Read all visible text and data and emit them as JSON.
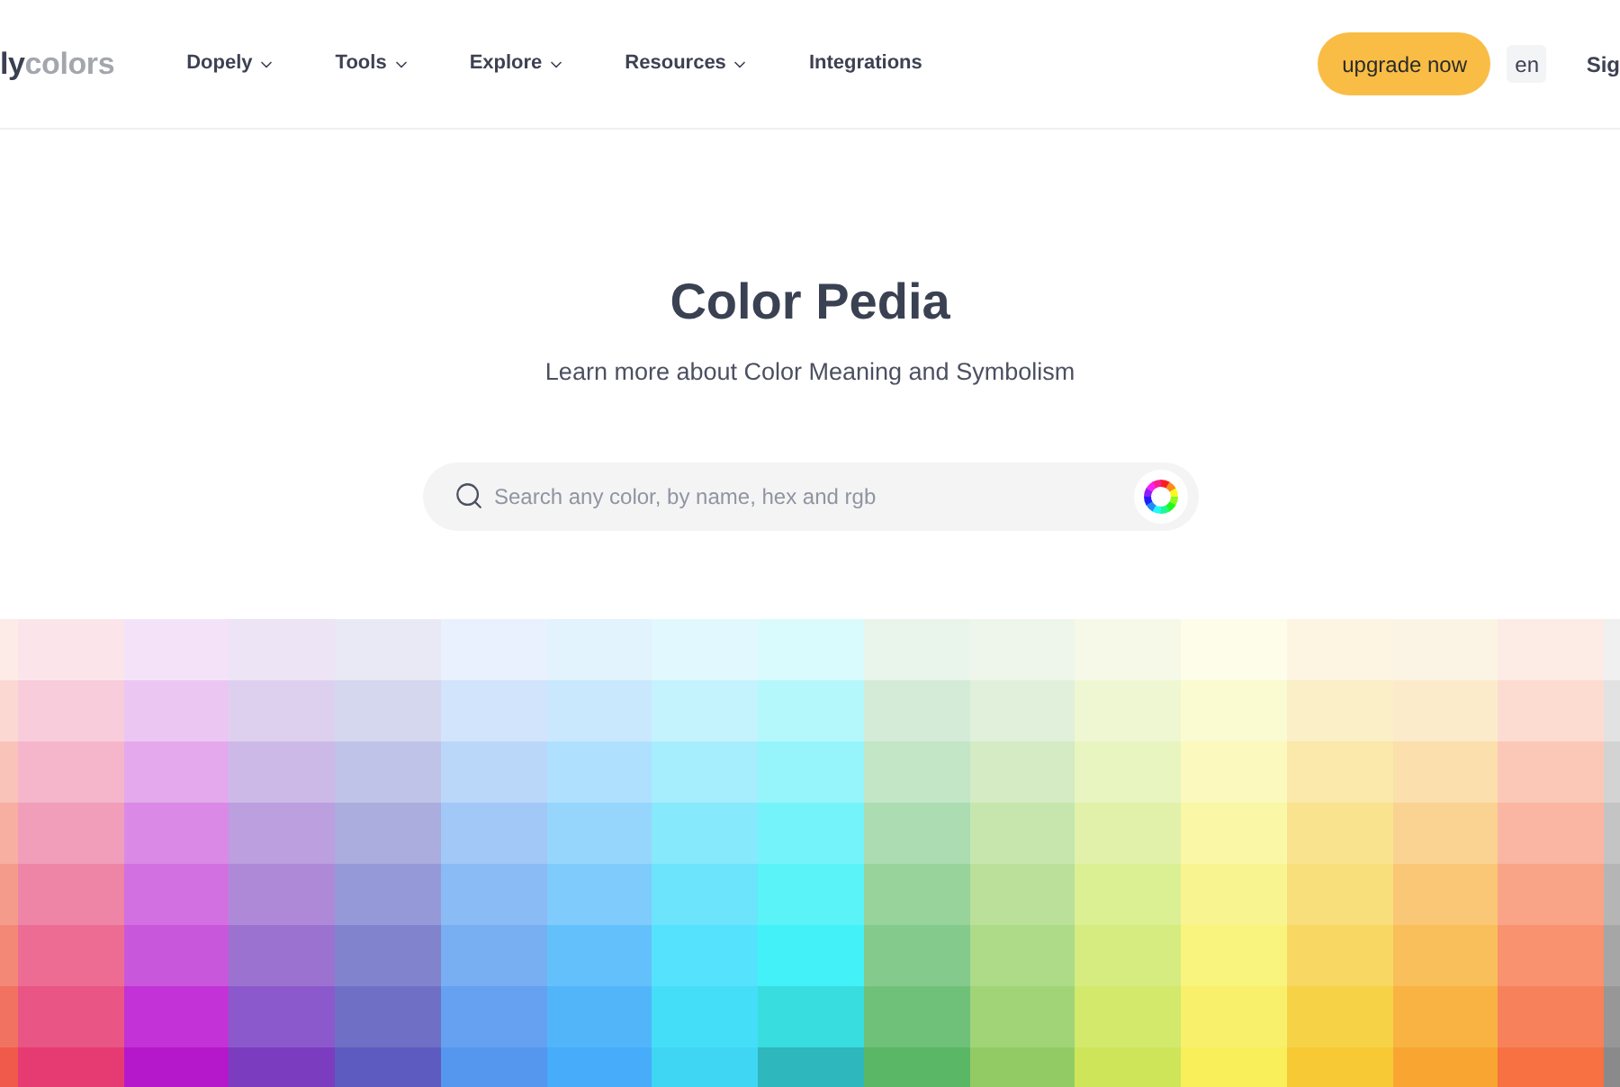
{
  "header": {
    "logo": {
      "dark_part": "ly",
      "light_part": "colors"
    },
    "nav": [
      {
        "label": "Dopely",
        "dropdown": true
      },
      {
        "label": "Tools",
        "dropdown": true
      },
      {
        "label": "Explore",
        "dropdown": true
      },
      {
        "label": "Resources",
        "dropdown": true
      },
      {
        "label": "Integrations",
        "dropdown": false
      }
    ],
    "upgrade_button": "upgrade now",
    "language": "en",
    "sign_in": "Sig"
  },
  "hero": {
    "title": "Color Pedia",
    "subtitle": "Learn more about Color Meaning and Symbolism",
    "search": {
      "placeholder": "Search any color, by name, hex and rgb"
    }
  },
  "color_grid": [
    {
      "swatches": [
        {
          "color": "#fdebe7"
        },
        {
          "color": "#fcd8d2"
        },
        {
          "color": "#f9c3ba"
        },
        {
          "color": "#f7afa2"
        },
        {
          "color": "#f59b8c"
        },
        {
          "color": "#f38877"
        },
        {
          "color": "#f27262"
        },
        {
          "color": "#f05a4a"
        }
      ]
    },
    {
      "swatches": [
        {
          "color": "#fbe5eb"
        },
        {
          "color": "#f8ccdb"
        },
        {
          "color": "#f5b6cb"
        },
        {
          "color": "#f19ebb"
        },
        {
          "color": "#ee84a6"
        },
        {
          "color": "#ec6c94"
        },
        {
          "color": "#e95584"
        },
        {
          "color": "#e63b72"
        }
      ]
    },
    {
      "swatches": [
        {
          "color": "#f4e3f8"
        },
        {
          "color": "#ecc6f2"
        },
        {
          "color": "#e3a9ec"
        },
        {
          "color": "#da8ae6"
        },
        {
          "color": "#d270e1"
        },
        {
          "color": "#c957db"
        },
        {
          "color": "#c232d6"
        },
        {
          "color": "#b518cb"
        }
      ]
    },
    {
      "swatches": [
        {
          "color": "#ede4f5"
        },
        {
          "color": "#ddd0ef"
        },
        {
          "color": "#cdb9e7"
        },
        {
          "color": "#bc9fdf"
        },
        {
          "color": "#ad89d8"
        },
        {
          "color": "#9b72d0"
        },
        {
          "color": "#8b59cb"
        },
        {
          "color": "#7b3cc0"
        }
      ]
    },
    {
      "swatches": [
        {
          "color": "#e8e9f5"
        },
        {
          "color": "#d4d7ee"
        },
        {
          "color": "#bfc3e7"
        },
        {
          "color": "#abaddf"
        },
        {
          "color": "#9699d7"
        },
        {
          "color": "#8184cd"
        },
        {
          "color": "#6f70c5"
        },
        {
          "color": "#5d5bbf"
        }
      ]
    },
    {
      "swatches": [
        {
          "color": "#e8f1fd"
        },
        {
          "color": "#d2e4fb"
        },
        {
          "color": "#bad7fa"
        },
        {
          "color": "#a1c8f7"
        },
        {
          "color": "#8bbbf4"
        },
        {
          "color": "#78aef2"
        },
        {
          "color": "#65a1f0"
        },
        {
          "color": "#5596ef"
        }
      ]
    },
    {
      "swatches": [
        {
          "color": "#e2f3fe"
        },
        {
          "color": "#c9e8fd"
        },
        {
          "color": "#afe0fd"
        },
        {
          "color": "#96d6fd"
        },
        {
          "color": "#7ecbfc"
        },
        {
          "color": "#64c0fb"
        },
        {
          "color": "#52b5f9"
        },
        {
          "color": "#47adfa"
        }
      ]
    },
    {
      "swatches": [
        {
          "color": "#e0f8fe"
        },
        {
          "color": "#c4f3fe"
        },
        {
          "color": "#a6edfd"
        },
        {
          "color": "#87e9fc"
        },
        {
          "color": "#6be4fc"
        },
        {
          "color": "#55e2fd"
        },
        {
          "color": "#45def9"
        },
        {
          "color": "#3fd6f3"
        }
      ]
    },
    {
      "swatches": [
        {
          "color": "#dafbfd"
        },
        {
          "color": "#b5f8fb"
        },
        {
          "color": "#95f5fb"
        },
        {
          "color": "#74f4fa"
        },
        {
          "color": "#5af3f8"
        },
        {
          "color": "#43f2f8"
        },
        {
          "color": "#38dde0"
        },
        {
          "color": "#2eb7bd"
        }
      ]
    },
    {
      "swatches": [
        {
          "color": "#e9f4ea"
        },
        {
          "color": "#d4ebd8"
        },
        {
          "color": "#c2e6c6"
        },
        {
          "color": "#acdcb1"
        },
        {
          "color": "#98d39c"
        },
        {
          "color": "#83ca8c"
        },
        {
          "color": "#6fc17a"
        },
        {
          "color": "#5ab765"
        }
      ]
    },
    {
      "swatches": [
        {
          "color": "#eef6ec"
        },
        {
          "color": "#e1f0da"
        },
        {
          "color": "#d4ebc4"
        },
        {
          "color": "#c6e6ae"
        },
        {
          "color": "#bbe09a"
        },
        {
          "color": "#addb88"
        },
        {
          "color": "#a0d477"
        },
        {
          "color": "#92cb63"
        }
      ]
    },
    {
      "swatches": [
        {
          "color": "#f6f9e7"
        },
        {
          "color": "#eff7d2"
        },
        {
          "color": "#e8f5c0"
        },
        {
          "color": "#e1f1a9"
        },
        {
          "color": "#dbef93"
        },
        {
          "color": "#d6ec80"
        },
        {
          "color": "#d2e96c"
        },
        {
          "color": "#cee55a"
        }
      ]
    },
    {
      "swatches": [
        {
          "color": "#fefde9"
        },
        {
          "color": "#fbfbd2"
        },
        {
          "color": "#fbf9bd"
        },
        {
          "color": "#faf7a6"
        },
        {
          "color": "#f8f590"
        },
        {
          "color": "#f8f47d"
        },
        {
          "color": "#f8f06b"
        },
        {
          "color": "#f8ef5a"
        }
      ]
    },
    {
      "swatches": [
        {
          "color": "#fdf4e2"
        },
        {
          "color": "#fbefc7"
        },
        {
          "color": "#fbe8ab"
        },
        {
          "color": "#f9e38f"
        },
        {
          "color": "#f9df7c"
        },
        {
          "color": "#f8d862"
        },
        {
          "color": "#f6d247"
        },
        {
          "color": "#f6c935"
        }
      ]
    },
    {
      "swatches": [
        {
          "color": "#fbf4e4"
        },
        {
          "color": "#fcebca"
        },
        {
          "color": "#fbdfac"
        },
        {
          "color": "#fad291"
        },
        {
          "color": "#fac776"
        },
        {
          "color": "#f8bf5b"
        },
        {
          "color": "#f8b342"
        },
        {
          "color": "#f8a631"
        }
      ]
    },
    {
      "swatches": [
        {
          "color": "#fdebe5"
        },
        {
          "color": "#fcdcd1"
        },
        {
          "color": "#fbc8b7"
        },
        {
          "color": "#fab6a2"
        },
        {
          "color": "#f9a487"
        },
        {
          "color": "#f8926f"
        },
        {
          "color": "#f7815a"
        },
        {
          "color": "#f77142"
        }
      ]
    },
    {
      "swatches": [
        {
          "color": "#f0f0f0"
        },
        {
          "color": "#e2e2e2"
        },
        {
          "color": "#d3d3d3"
        },
        {
          "color": "#c4c4c4"
        },
        {
          "color": "#b5b5b5"
        },
        {
          "color": "#a6a6a6"
        },
        {
          "color": "#979797"
        },
        {
          "color": "#8a8a8a"
        }
      ]
    }
  ]
}
